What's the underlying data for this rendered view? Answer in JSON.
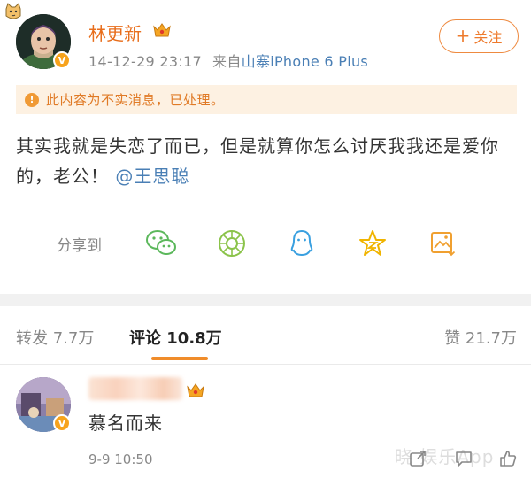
{
  "post": {
    "username": "林更新",
    "timestamp": "14-12-29 23:17",
    "source_label": "来自",
    "source_device": "山寨iPhone 6 Plus",
    "follow_label": "关注",
    "follow_plus": "+",
    "verified_mark": "V",
    "notice": "此内容为不实消息，已处理。",
    "notice_icon": "!",
    "content_text": "其实我就是失恋了而已，但是就算你怎么讨厌我我还是爱你的，老公！",
    "mention": "@王思聪",
    "share_label": "分享到",
    "share_icons": [
      "wechat-icon",
      "moments-icon",
      "qq-icon",
      "qzone-icon",
      "save-image-icon"
    ]
  },
  "tabs": {
    "repost": "转发 7.7万",
    "comments": "评论 10.8万",
    "likes": "赞 21.7万"
  },
  "comment": {
    "text": "慕名而来",
    "time": "9-9 10:50",
    "watermark": "晓 娱乐App",
    "verified_mark": "V"
  },
  "colors": {
    "accent": "#f08c2a",
    "username": "#e86e1c",
    "link": "#4a7fb5",
    "notice_bg": "#fdf1e2"
  }
}
